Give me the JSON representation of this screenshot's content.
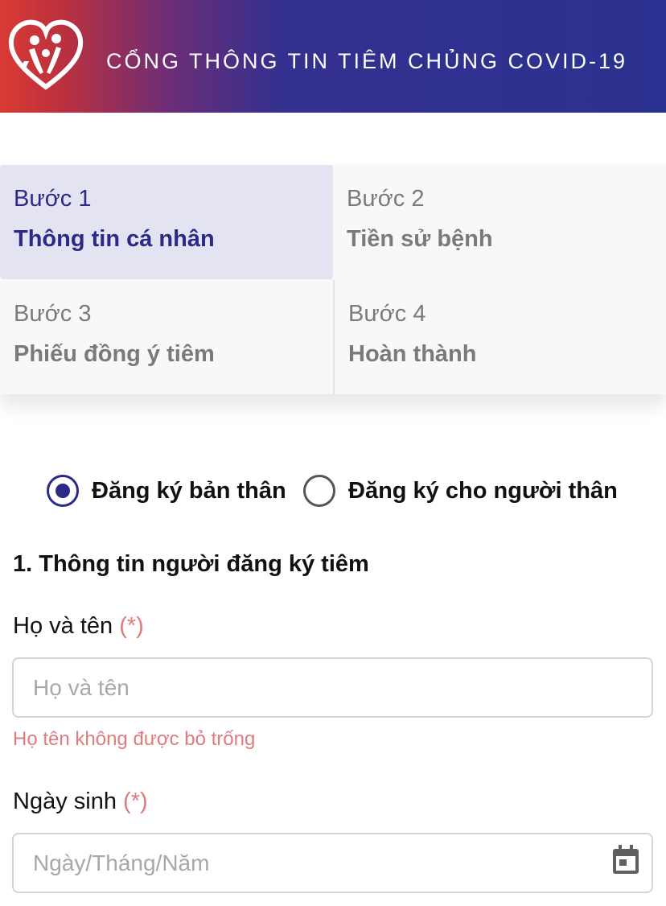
{
  "header": {
    "title": "CỔNG THÔNG TIN TIÊM CHỦNG COVID-19",
    "logo_icon": "heart-family-logo-icon",
    "gradient_colors": [
      "#d93a33",
      "#34308f",
      "#2b3190"
    ]
  },
  "steps": [
    {
      "num": "Bước 1",
      "name": "Thông tin cá nhân",
      "active": true
    },
    {
      "num": "Bước 2",
      "name": "Tiền sử bệnh",
      "active": false
    },
    {
      "num": "Bước 3",
      "name": "Phiếu đồng ý tiêm",
      "active": false
    },
    {
      "num": "Bước 4",
      "name": "Hoàn thành",
      "active": false
    }
  ],
  "registration_type": {
    "options": [
      {
        "label": "Đăng ký bản thân",
        "selected": true
      },
      {
        "label": "Đăng ký cho người thân",
        "selected": false
      }
    ]
  },
  "section": {
    "title": "1. Thông tin người đăng ký tiêm"
  },
  "form": {
    "full_name": {
      "label": "Họ và tên",
      "required_mark": "(*)",
      "placeholder": "Họ và tên",
      "value": "",
      "error": "Họ tên không được bỏ trống"
    },
    "birth_date": {
      "label": "Ngày sinh",
      "required_mark": "(*)",
      "placeholder": "Ngày/Tháng/Năm",
      "value": "",
      "icon": "calendar-icon"
    }
  },
  "colors": {
    "primary": "#2b2a87",
    "active_step_bg": "#e3e3f1",
    "required": "#e07b7b"
  }
}
